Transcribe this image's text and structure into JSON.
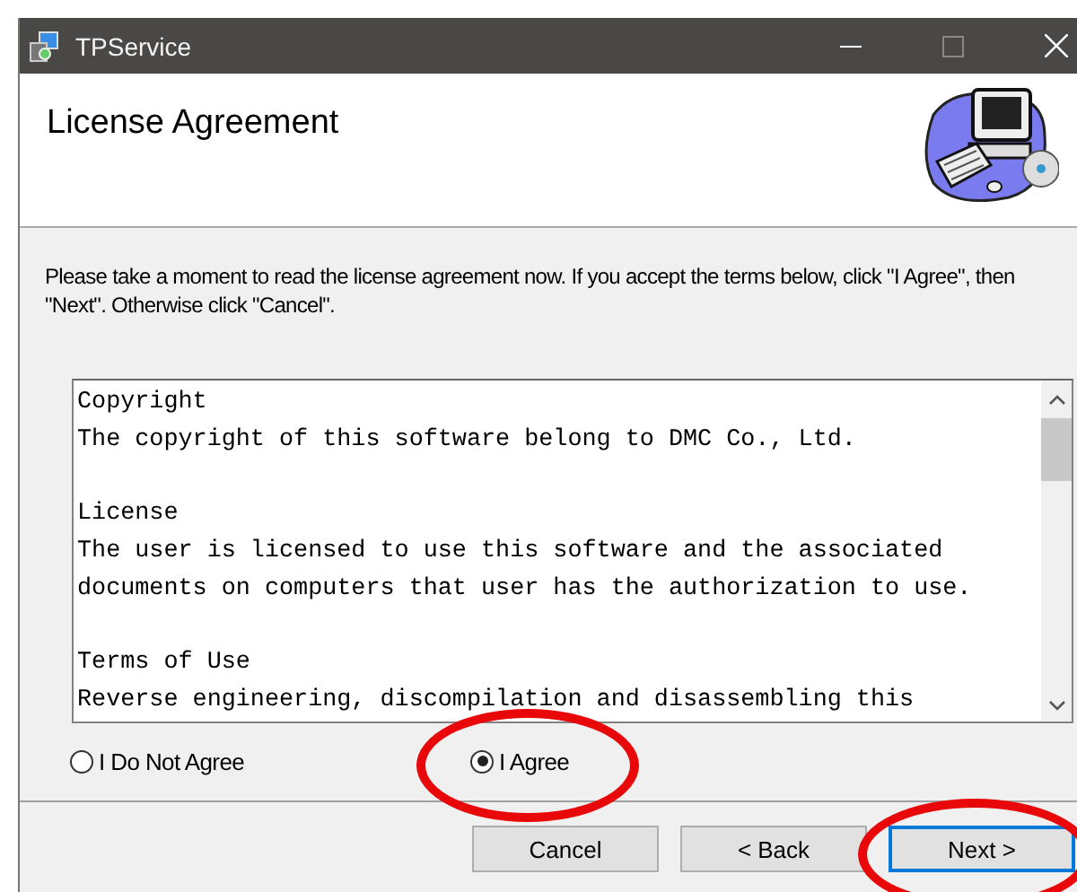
{
  "window": {
    "title": "TPService"
  },
  "header": {
    "title": "License Agreement"
  },
  "instructions": "Please take a moment to read the license agreement now. If you accept the terms below, click \"I Agree\", then \"Next\". Otherwise click \"Cancel\".",
  "license_text": [
    {
      "heading": "Copyright",
      "lines": [
        "The copyright of this software belong to DMC Co., Ltd."
      ]
    },
    {
      "heading": "License",
      "lines": [
        "The user is licensed to use this software and the associated",
        "documents on computers that user has the authorization to use."
      ]
    },
    {
      "heading": "Terms of Use",
      "lines": [
        "Reverse engineering, discompilation and disassembling this"
      ]
    }
  ],
  "radios": [
    {
      "label": "I Do Not Agree",
      "selected": false,
      "circled": false
    },
    {
      "label": "I Agree",
      "selected": true,
      "circled": true
    }
  ],
  "buttons": [
    {
      "label": "Cancel",
      "default": false,
      "circled": false
    },
    {
      "label": "< Back",
      "default": false,
      "circled": false
    },
    {
      "label": "Next >",
      "default": true,
      "circled": true
    }
  ]
}
